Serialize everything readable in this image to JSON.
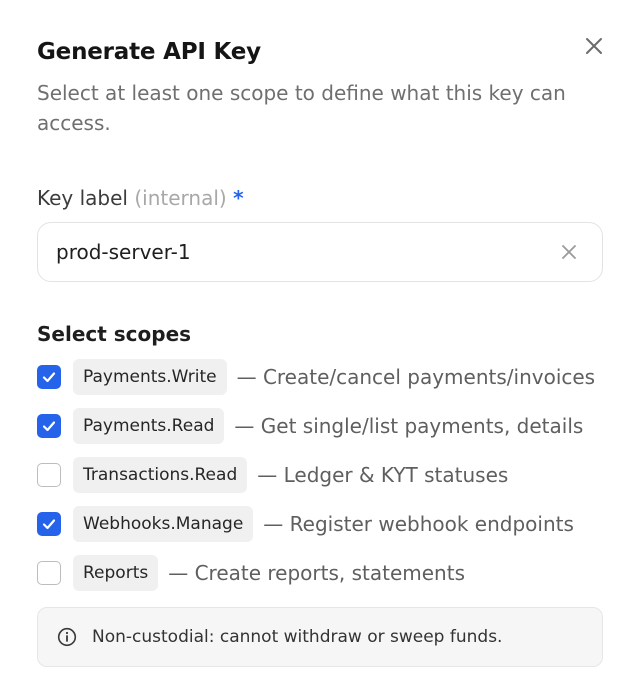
{
  "dialog": {
    "title": "Generate API Key",
    "subtitle": "Select at least one scope to define what this key can access.",
    "close_icon": "close-icon"
  },
  "key_field": {
    "label": "Key label",
    "hint": "(internal)",
    "required_marker": "*",
    "value": "prod-server-1",
    "clear_icon": "clear-icon"
  },
  "scopes": {
    "title": "Select scopes",
    "items": [
      {
        "name": "Payments.Write",
        "separator": "—",
        "description": "Create/cancel payments/invoices",
        "checked": true
      },
      {
        "name": "Payments.Read",
        "separator": "—",
        "description": "Get single/list payments, details",
        "checked": true
      },
      {
        "name": "Transactions.Read",
        "separator": "—",
        "description": "Ledger & KYT statuses",
        "checked": false
      },
      {
        "name": "Webhooks.Manage",
        "separator": "—",
        "description": "Register webhook endpoints",
        "checked": true
      },
      {
        "name": "Reports",
        "separator": "—",
        "description": "Create reports, statements",
        "checked": false
      }
    ]
  },
  "notice": {
    "icon": "info-icon",
    "text": "Non-custodial: cannot withdraw or sweep funds."
  },
  "colors": {
    "accent": "#2563eb",
    "chip_bg": "#f0f0f0",
    "notice_bg": "#f6f6f6"
  }
}
